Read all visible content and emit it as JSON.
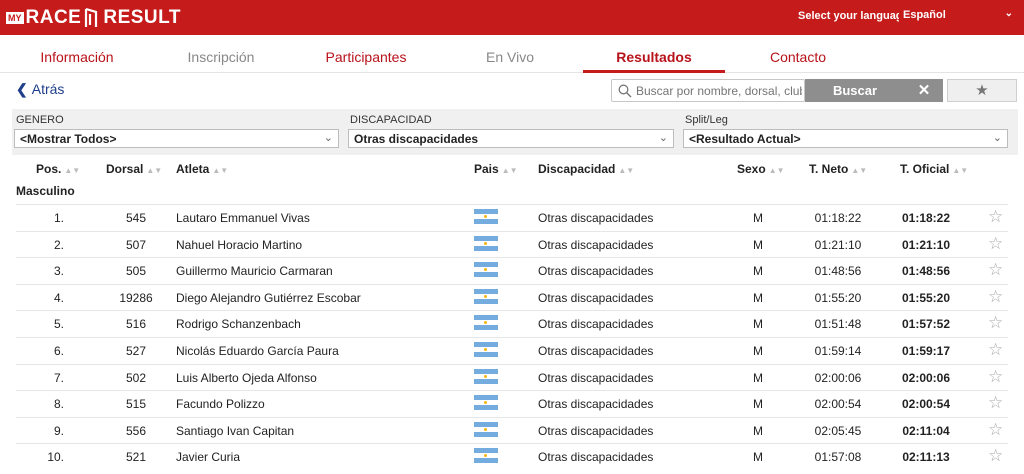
{
  "brand": {
    "my": "MY",
    "race": "RACE",
    "result": "RESULT"
  },
  "language": {
    "label": "Select your language:",
    "value": "Español"
  },
  "nav": {
    "tabs": [
      {
        "label": "Información"
      },
      {
        "label": "Inscripción"
      },
      {
        "label": "Participantes"
      },
      {
        "label": "En Vivo"
      },
      {
        "label": "Resultados"
      },
      {
        "label": "Contacto"
      }
    ]
  },
  "toolbar": {
    "back_label": "Atrás",
    "search_placeholder": "Buscar por nombre, dorsal, club",
    "search_label": "Buscar",
    "clear_label": "✕",
    "favorites_label": "★"
  },
  "filters": {
    "gender": {
      "label": "GENERO",
      "value": "<Mostrar Todos>"
    },
    "disability": {
      "label": "DISCAPACIDAD",
      "value": "Otras discapacidades"
    },
    "split": {
      "label": "Split/Leg",
      "value": "<Resultado Actual>"
    }
  },
  "table": {
    "headers": {
      "pos": "Pos.",
      "bib": "Dorsal",
      "athlete": "Atleta",
      "country": "Pais",
      "disability": "Discapacidad",
      "sex": "Sexo",
      "net": "T. Neto",
      "official": "T. Oficial"
    },
    "group_label": "Masculino",
    "rows": [
      {
        "pos": "1.",
        "bib": "545",
        "name": "Lautaro Emmanuel Vivas",
        "disability": "Otras discapacidades",
        "sex": "M",
        "net": "01:18:22",
        "official": "01:18:22"
      },
      {
        "pos": "2.",
        "bib": "507",
        "name": "Nahuel Horacio Martino",
        "disability": "Otras discapacidades",
        "sex": "M",
        "net": "01:21:10",
        "official": "01:21:10"
      },
      {
        "pos": "3.",
        "bib": "505",
        "name": "Guillermo Mauricio Carmaran",
        "disability": "Otras discapacidades",
        "sex": "M",
        "net": "01:48:56",
        "official": "01:48:56"
      },
      {
        "pos": "4.",
        "bib": "19286",
        "name": "Diego Alejandro Gutiérrez Escobar",
        "disability": "Otras discapacidades",
        "sex": "M",
        "net": "01:55:20",
        "official": "01:55:20"
      },
      {
        "pos": "5.",
        "bib": "516",
        "name": "Rodrigo Schanzenbach",
        "disability": "Otras discapacidades",
        "sex": "M",
        "net": "01:51:48",
        "official": "01:57:52"
      },
      {
        "pos": "6.",
        "bib": "527",
        "name": "Nicolás Eduardo García Paura",
        "disability": "Otras discapacidades",
        "sex": "M",
        "net": "01:59:14",
        "official": "01:59:17"
      },
      {
        "pos": "7.",
        "bib": "502",
        "name": "Luis Alberto Ojeda Alfonso",
        "disability": "Otras discapacidades",
        "sex": "M",
        "net": "02:00:06",
        "official": "02:00:06"
      },
      {
        "pos": "8.",
        "bib": "515",
        "name": "Facundo Polizzo",
        "disability": "Otras discapacidades",
        "sex": "M",
        "net": "02:00:54",
        "official": "02:00:54"
      },
      {
        "pos": "9.",
        "bib": "556",
        "name": "Santiago Ivan Capitan",
        "disability": "Otras discapacidades",
        "sex": "M",
        "net": "02:05:45",
        "official": "02:11:04"
      },
      {
        "pos": "10.",
        "bib": "521",
        "name": "Javier Curia",
        "disability": "Otras discapacidades",
        "sex": "M",
        "net": "01:57:08",
        "official": "02:11:13"
      }
    ]
  },
  "colors": {
    "brand_red": "#c61b1b",
    "link_blue": "#1f3f8a",
    "flag_blue": "#74acdf"
  }
}
